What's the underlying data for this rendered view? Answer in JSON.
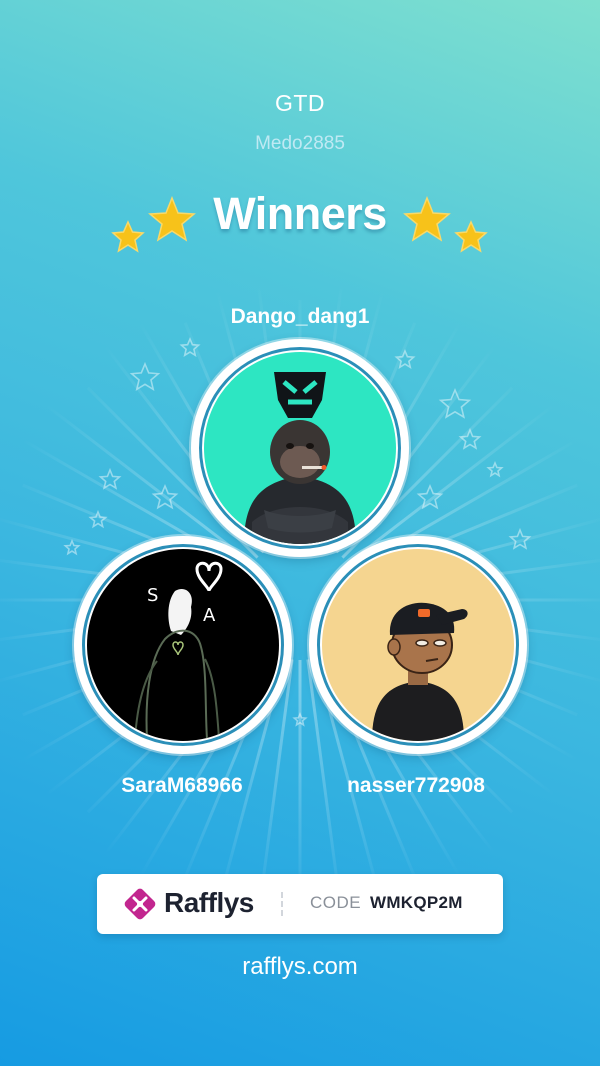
{
  "header": {
    "title": "GTD",
    "subtitle": "Medo2885",
    "heading": "Winners"
  },
  "winners": [
    {
      "username": "Dango_dang1",
      "avatar_icon": "gorilla-avatar",
      "avatar_bg": "#2de6c2"
    },
    {
      "username": "SaraM68966",
      "avatar_icon": "dark-figure-avatar",
      "avatar_bg": "#000000"
    },
    {
      "username": "nasser772908",
      "avatar_icon": "cartoon-boy-avatar",
      "avatar_bg": "#f5d590"
    }
  ],
  "footer": {
    "brand_name": "Rafflys",
    "code_label": "CODE",
    "code_value": "WMKQP2M",
    "site": "rafflys.com"
  },
  "colors": {
    "star": "#f7c21a",
    "ring_border": "#2b8fb8",
    "brand_magenta": "#c2268f"
  }
}
